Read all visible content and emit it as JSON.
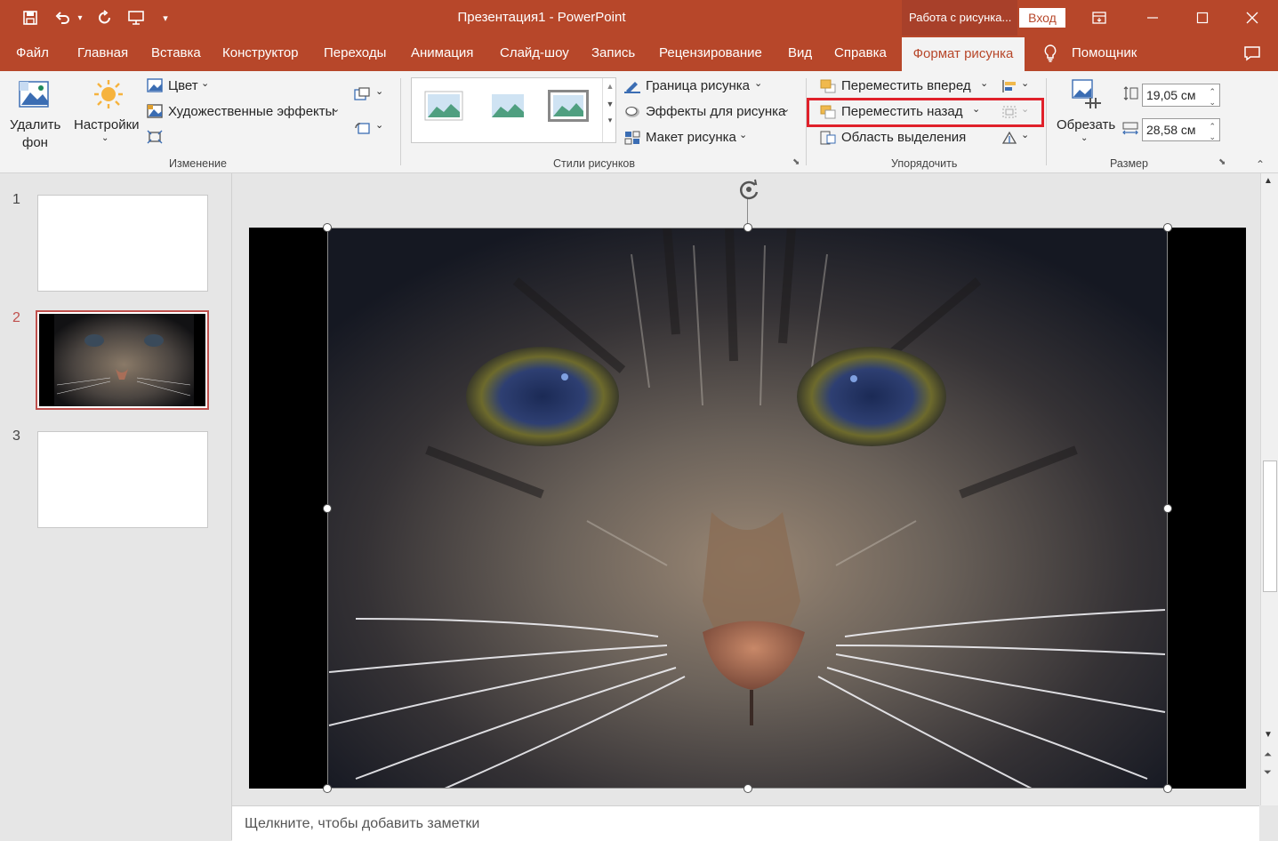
{
  "window": {
    "title": "Презентация1  -  PowerPoint",
    "context_tab_group": "Работа с рисунка...",
    "sign_in": "Вход"
  },
  "tabs": [
    "Файл",
    "Главная",
    "Вставка",
    "Конструктор",
    "Переходы",
    "Анимация",
    "Слайд-шоу",
    "Запись",
    "Рецензирование",
    "Вид",
    "Справка",
    "Формат рисунка",
    "Помощник"
  ],
  "active_tab": "Формат рисунка",
  "ribbon": {
    "adjust": {
      "remove_bg_line1": "Удалить",
      "remove_bg_line2": "фон",
      "corrections": "Настройки",
      "color": "Цвет",
      "artistic": "Художественные эффекты",
      "group_label": "Изменение"
    },
    "styles": {
      "border": "Граница рисунка",
      "effects": "Эффекты для рисунка",
      "layout": "Макет рисунка",
      "group_label": "Стили рисунков"
    },
    "arrange": {
      "bring_forward": "Переместить вперед",
      "send_backward": "Переместить назад",
      "selection_pane": "Область выделения",
      "group_label": "Упорядочить",
      "highlight_color": "#e0202a"
    },
    "size": {
      "crop": "Обрезать",
      "height": "19,05 см",
      "width": "28,58 см",
      "group_label": "Размер"
    }
  },
  "slides": [
    {
      "number": "1"
    },
    {
      "number": "2"
    },
    {
      "number": "3"
    }
  ],
  "selected_slide": "2",
  "notes_placeholder": "Щелкните, чтобы добавить заметки",
  "colors": {
    "accent": "#b7472a",
    "ribbon_bg": "#f3f3f3",
    "workspace_bg": "#e6e6e6"
  }
}
